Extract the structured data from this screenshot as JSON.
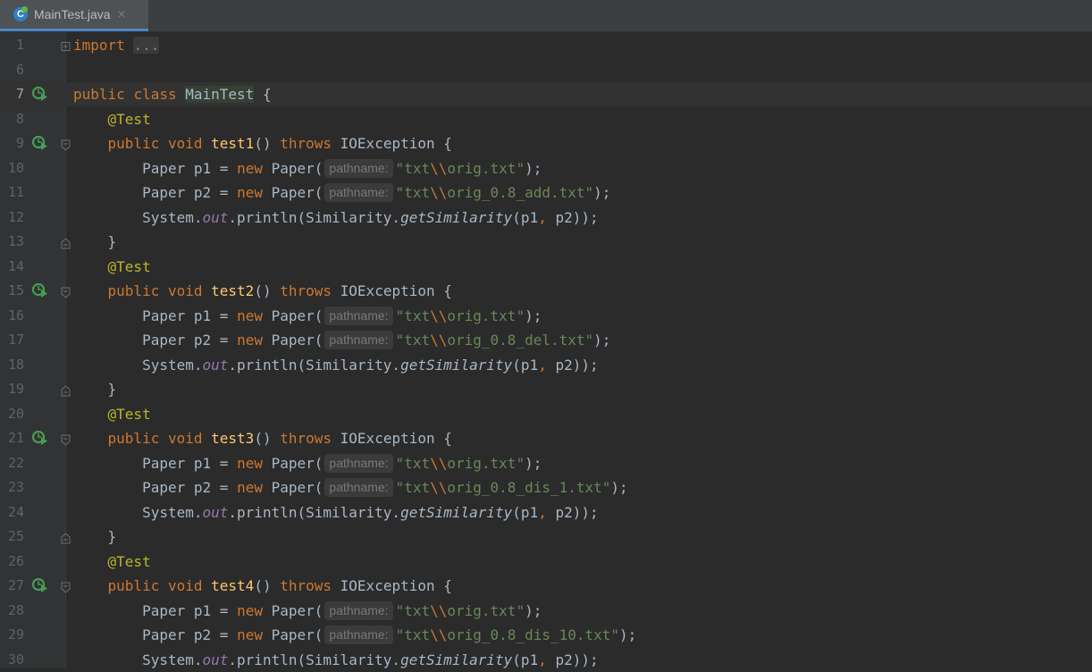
{
  "tab": {
    "title": "MainTest.java",
    "close": "×",
    "icon": "java-class-icon"
  },
  "code": {
    "import_kw": "import",
    "import_folded": "...",
    "class_decl": {
      "public": "public",
      "class": "class",
      "name": "MainTest",
      "brace": "{"
    },
    "annotation": "@Test",
    "public": "public",
    "void": "void",
    "throws": "throws",
    "exception": "IOException",
    "paren": "()",
    "open_brace": "{",
    "close_brace": "}",
    "paper": "Paper",
    "new": "new",
    "paper_ctor": "Paper(",
    "hint": "pathname:",
    "str_prefix": "\"txt",
    "str_escape": "\\\\",
    "close_call": ");",
    "equals": "=",
    "system": "System.",
    "out": "out",
    "println": ".println(Similarity.",
    "get_similarity": "getSimilarity",
    "args_open": "(p1",
    "comma": ",",
    "args_close": " p2));",
    "p1": "p1",
    "p2": "p2",
    "tests": [
      {
        "name": "test1",
        "file1": "orig.txt\"",
        "file2": "orig_0.8_add.txt\""
      },
      {
        "name": "test2",
        "file1": "orig.txt\"",
        "file2": "orig_0.8_del.txt\""
      },
      {
        "name": "test3",
        "file1": "orig.txt\"",
        "file2": "orig_0.8_dis_1.txt\""
      },
      {
        "name": "test4",
        "file1": "orig.txt\"",
        "file2": "orig_0.8_dis_10.txt\""
      }
    ]
  },
  "line_numbers": [
    "1",
    "6",
    "7",
    "8",
    "9",
    "10",
    "11",
    "12",
    "13",
    "14",
    "15",
    "16",
    "17",
    "18",
    "19",
    "20",
    "21",
    "22",
    "23",
    "24",
    "25",
    "26",
    "27",
    "28",
    "29",
    "30"
  ],
  "colors": {
    "keyword": "#cc7832",
    "function": "#ffc66d",
    "annotation": "#bbb529",
    "string": "#6a8759",
    "static_field": "#9876aa",
    "text": "#a9b7c6",
    "background": "#2b2b2b"
  }
}
